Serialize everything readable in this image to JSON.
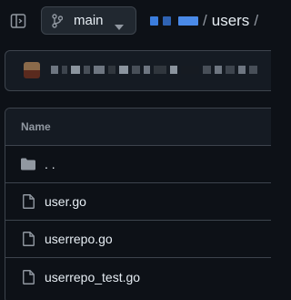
{
  "header": {
    "sidebar_toggle_icon": "sidebar-panel-icon",
    "branch": {
      "icon": "git-branch-icon",
      "name": "main",
      "caret_icon": "triangle-down-icon"
    },
    "breadcrumb": {
      "separator": "/",
      "segment": "users",
      "trailing_separator": "/"
    }
  },
  "table": {
    "header_label": "Name",
    "rows": [
      {
        "icon": "folder-icon",
        "name": ". ."
      },
      {
        "icon": "file-icon",
        "name": "user.go"
      },
      {
        "icon": "file-icon",
        "name": "userrepo.go"
      },
      {
        "icon": "file-icon",
        "name": "userrepo_test.go"
      }
    ]
  },
  "colors": {
    "background": "#0d1117",
    "surface": "#151b23",
    "border": "#3d444d",
    "text": "#e6edf3",
    "muted": "#9198a1"
  }
}
